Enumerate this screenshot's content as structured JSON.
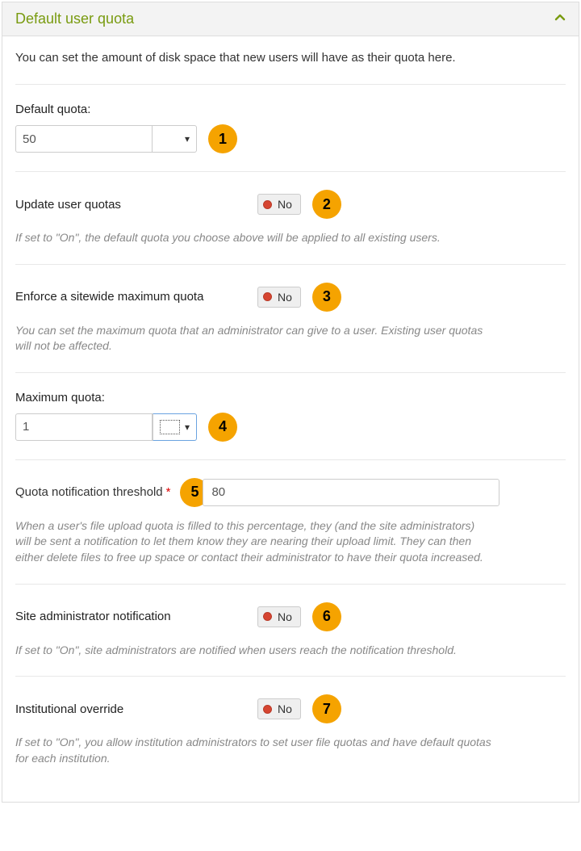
{
  "panel": {
    "title": "Default user quota"
  },
  "intro": "You can set the amount of disk space that new users will have as their quota here.",
  "defaultQuota": {
    "label": "Default quota:",
    "value": "50",
    "badge": "1"
  },
  "updateQuotas": {
    "label": "Update user quotas",
    "toggle": "No",
    "badge": "2",
    "help": "If set to \"On\", the default quota you choose above will be applied to all existing users."
  },
  "enforceMax": {
    "label": "Enforce a sitewide maximum quota",
    "toggle": "No",
    "badge": "3",
    "help": "You can set the maximum quota that an administrator can give to a user. Existing user quotas will not be affected."
  },
  "maxQuota": {
    "label": "Maximum quota:",
    "value": "1",
    "badge": "4"
  },
  "threshold": {
    "label": "Quota notification threshold",
    "required": "*",
    "value": "80",
    "badge": "5",
    "help": "When a user's file upload quota is filled to this percentage, they (and the site administrators) will be sent a notification to let them know they are nearing their upload limit. They can then either delete files to free up space or contact their administrator to have their quota increased."
  },
  "adminNotif": {
    "label": "Site administrator notification",
    "toggle": "No",
    "badge": "6",
    "help": "If set to \"On\", site administrators are notified when users reach the notification threshold."
  },
  "instOverride": {
    "label": "Institutional override",
    "toggle": "No",
    "badge": "7",
    "help": "If set to \"On\", you allow institution administrators to set user file quotas and have default quotas for each institution."
  }
}
